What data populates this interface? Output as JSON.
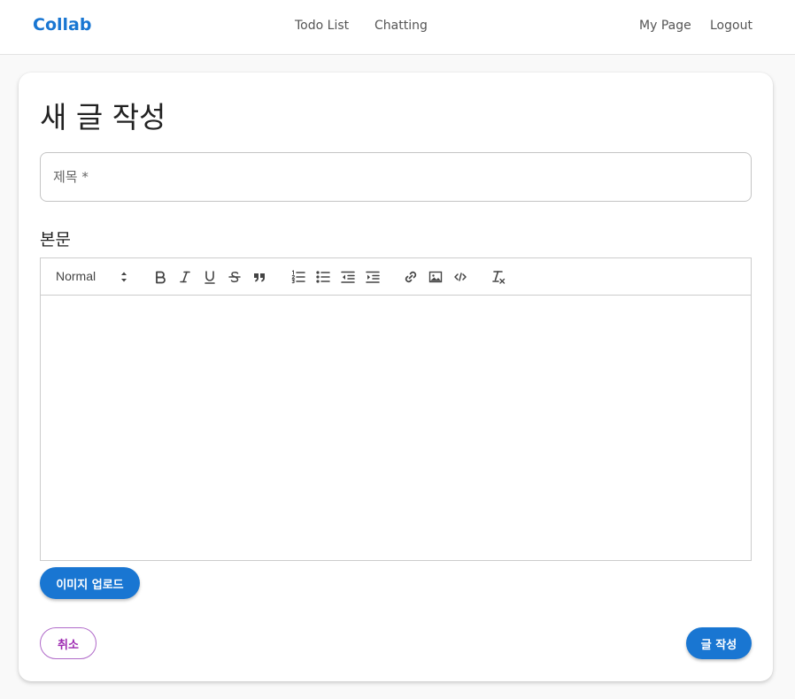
{
  "navbar": {
    "brand": "Collab",
    "links": [
      "Todo List",
      "Chatting"
    ],
    "user_links": [
      "My Page",
      "Logout"
    ],
    "accent_color": "#1976d2"
  },
  "page": {
    "title": "새 글 작성",
    "title_field": {
      "placeholder": "제목 *",
      "value": ""
    },
    "body_label": "본문"
  },
  "editor": {
    "format_select": "Normal",
    "toolbar_icons": [
      "bold-icon",
      "italic-icon",
      "underline-icon",
      "strikethrough-icon",
      "blockquote-icon",
      "ordered-list-icon",
      "bullet-list-icon",
      "outdent-icon",
      "indent-icon",
      "link-icon",
      "image-icon",
      "code-icon",
      "clear-format-icon"
    ],
    "content": ""
  },
  "buttons": {
    "upload_image": "이미지 업로드",
    "cancel": "취소",
    "submit": "글 작성"
  },
  "colors": {
    "primary": "#1976d2",
    "secondary": "#9c27b0"
  }
}
